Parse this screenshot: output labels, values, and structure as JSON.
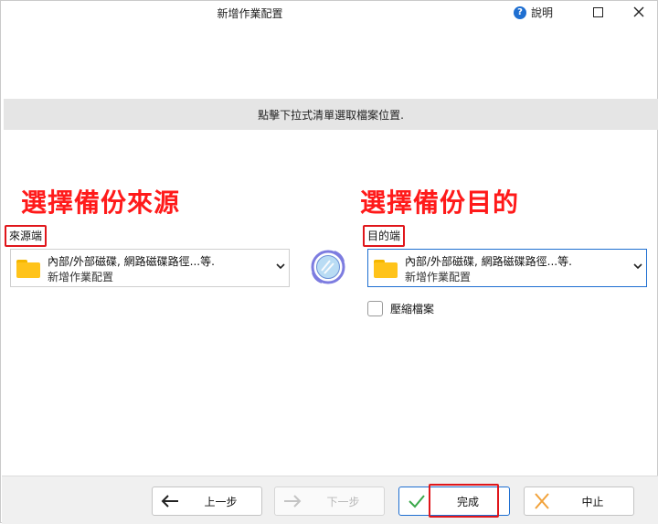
{
  "window": {
    "title": "新增作業配置",
    "help_label": "說明"
  },
  "banner": {
    "text": "點擊下拉式清單選取檔案位置."
  },
  "annotations": {
    "source_note": "選擇備份來源",
    "destination_note": "選擇備份目的",
    "color": "#ff1a1a"
  },
  "source": {
    "label": "來源端",
    "line1": "內部/外部磁碟, 網路磁碟路徑...等.",
    "line2": "新增作業配置",
    "icon": "folder-icon"
  },
  "destination": {
    "label": "目的端",
    "line1": "內部/外部磁碟, 網路磁碟路徑...等.",
    "line2": "新增作業配置",
    "icon": "folder-icon"
  },
  "options": {
    "compress_label": "壓縮檔案",
    "compress_checked": false
  },
  "footer": {
    "prev_label": "上一步",
    "next_label": "下一步",
    "finish_label": "完成",
    "cancel_label": "中止"
  },
  "colors": {
    "accent": "#1f6fd1",
    "folder": "#ffc31a",
    "banner_bg": "#e5e5e5",
    "highlight_red": "#e0161b"
  }
}
